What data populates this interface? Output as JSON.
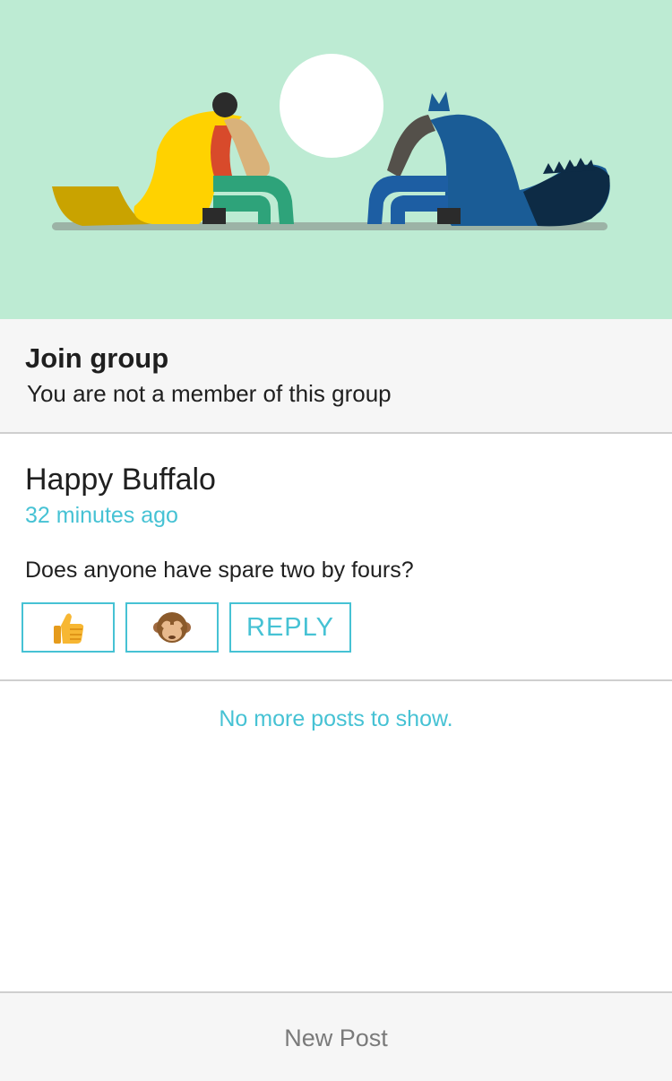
{
  "join": {
    "title": "Join group",
    "subtitle": "You are not a member of this group"
  },
  "post": {
    "author": "Happy Buffalo",
    "time": "32 minutes ago",
    "body": "Does anyone have spare two by fours?",
    "actions": {
      "like_icon": "thumbs-up-icon",
      "monkey_icon": "see-no-evil-monkey-icon",
      "reply_label": "REPLY"
    }
  },
  "feed": {
    "end_message": "No more posts to show."
  },
  "footer": {
    "new_post_label": "New Post"
  },
  "colors": {
    "accent": "#46c2d4",
    "hero_background": "#bdebd3"
  }
}
